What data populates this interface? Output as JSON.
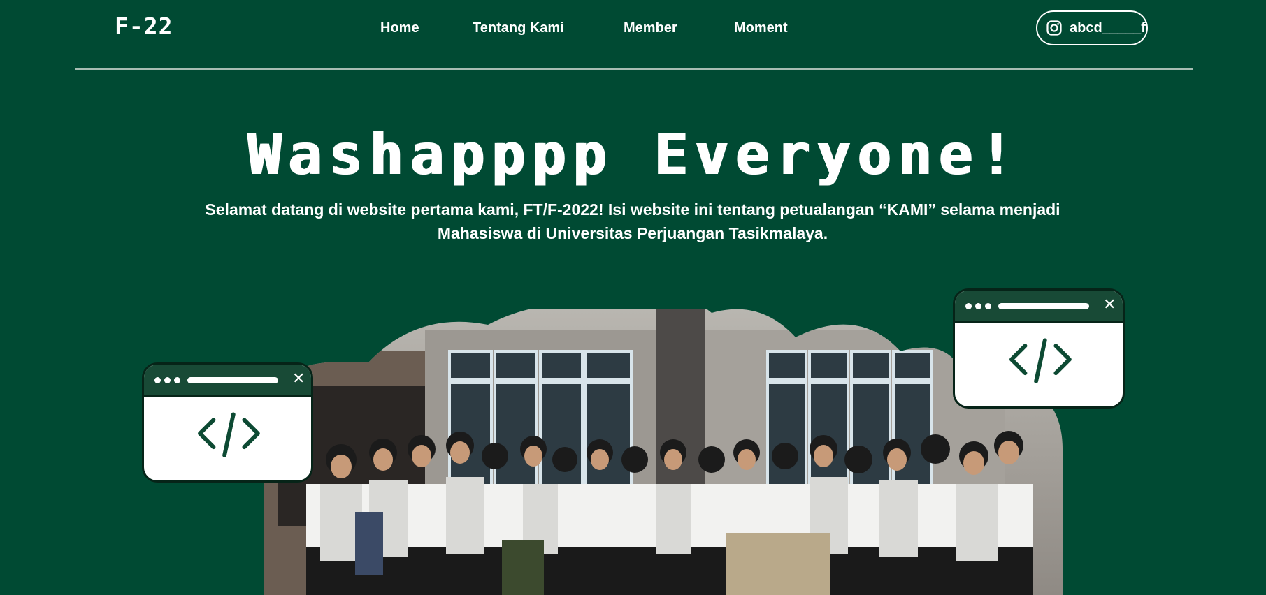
{
  "brand": {
    "logo": "F-22"
  },
  "nav": {
    "items": [
      {
        "label": "Home"
      },
      {
        "label": "Tentang Kami"
      },
      {
        "label": "Member"
      },
      {
        "label": "Moment"
      }
    ]
  },
  "instagram": {
    "icon": "instagram-icon",
    "handle": "abcd_____f"
  },
  "hero": {
    "title": "Washapppp Everyone!",
    "subtitle_line1": "Selamat datang di website pertama kami, FT/F-2022! Isi website ini tentang petualangan “KAMI” selama menjadi",
    "subtitle_line2": "Mahasiswa di Universitas Perjuangan Tasikmalaya."
  },
  "code_windows": [
    {
      "close_label": "✕",
      "icon": "code-icon"
    },
    {
      "close_label": "✕",
      "icon": "code-icon"
    }
  ],
  "colors": {
    "background": "#004a33",
    "window_bar": "#184a36",
    "accent_white": "#ffffff"
  }
}
